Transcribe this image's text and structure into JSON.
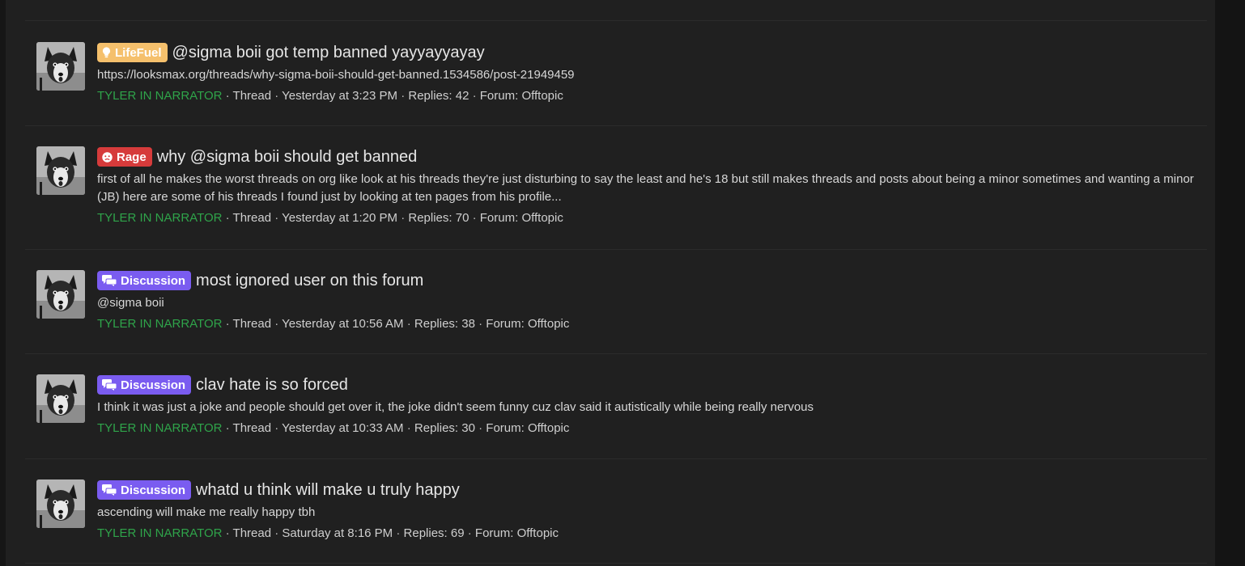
{
  "colors": {
    "page_bg": "#161616",
    "panel_bg": "#202020",
    "username": "#2fa44a",
    "label_lifefuel": "#f5c06c",
    "label_rage": "#d63b3b",
    "label_discussion": "#7a5cf0"
  },
  "results": [
    {
      "label": "LifeFuel",
      "label_icon": "lightbulb-icon",
      "title": "@sigma boii got temp banned yayyayyayay",
      "snippet": "https://looksmax.org/threads/why-sigma-boii-should-get-banned.1534586/post-21949459",
      "user": "TYLER IN NARRATOR",
      "type": "Thread",
      "date": "Yesterday at 3:23 PM",
      "replies": "Replies: 42",
      "forum": "Forum: Offtopic"
    },
    {
      "label": "Rage",
      "label_icon": "angry-face-icon",
      "title": "why @sigma boii should get banned",
      "snippet": "first of all he makes the worst threads on org like look at his threads they're just disturbing to say the least and he's 18 but still makes threads and posts about being a minor sometimes and wanting a minor (JB) here are some of his threads I found just by looking at ten pages from his profile...",
      "user": "TYLER IN NARRATOR",
      "type": "Thread",
      "date": "Yesterday at 1:20 PM",
      "replies": "Replies: 70",
      "forum": "Forum: Offtopic"
    },
    {
      "label": "Discussion",
      "label_icon": "chat-bubbles-icon",
      "title": "most ignored user on this forum",
      "snippet": "@sigma boii",
      "user": "TYLER IN NARRATOR",
      "type": "Thread",
      "date": "Yesterday at 10:56 AM",
      "replies": "Replies: 38",
      "forum": "Forum: Offtopic"
    },
    {
      "label": "Discussion",
      "label_icon": "chat-bubbles-icon",
      "title": "clav hate is so forced",
      "snippet": "I think it was just a joke and people should get over it, the joke didn't seem funny cuz clav said it autistically while being really nervous",
      "user": "TYLER IN NARRATOR",
      "type": "Thread",
      "date": "Yesterday at 10:33 AM",
      "replies": "Replies: 30",
      "forum": "Forum: Offtopic"
    },
    {
      "label": "Discussion",
      "label_icon": "chat-bubbles-icon",
      "title": "whatd u think will make u truly happy",
      "snippet": "ascending will make me really happy tbh",
      "user": "TYLER IN NARRATOR",
      "type": "Thread",
      "date": "Saturday at 8:16 PM",
      "replies": "Replies: 69",
      "forum": "Forum: Offtopic"
    }
  ]
}
